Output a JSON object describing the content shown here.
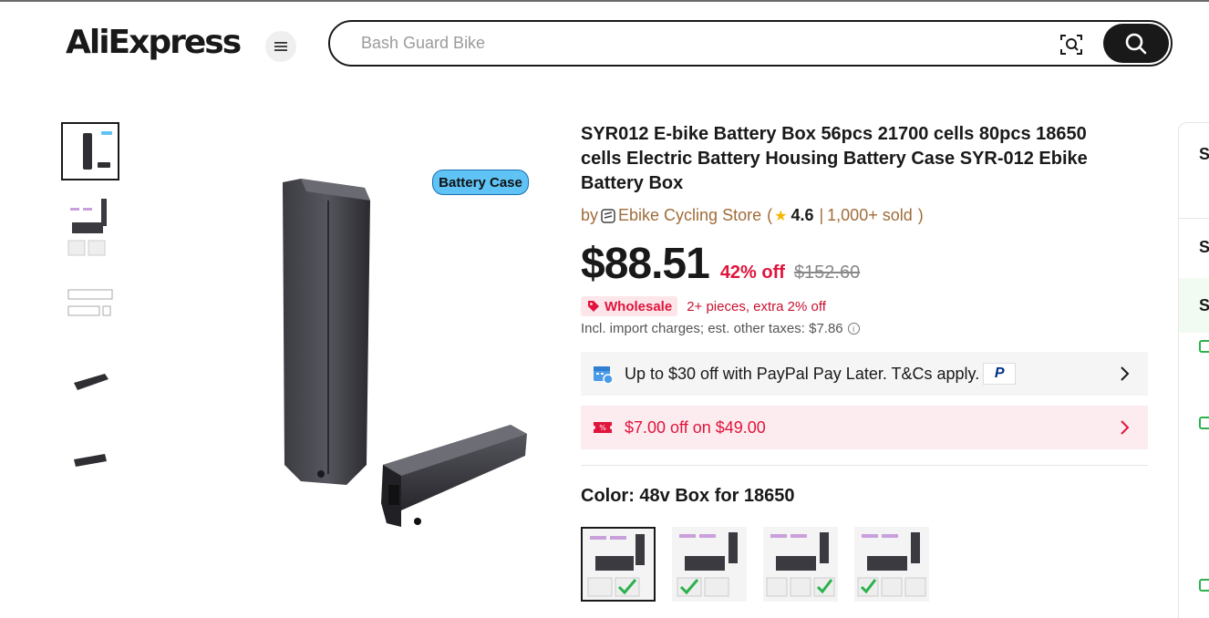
{
  "header": {
    "logo_text": "AliExpress",
    "search_placeholder": "Bash Guard Bike"
  },
  "gallery": {
    "badge_text": "Battery Case",
    "thumbnails": [
      "thumb-1",
      "thumb-2",
      "thumb-3",
      "thumb-4",
      "thumb-5"
    ]
  },
  "product": {
    "title": "SYR012 E-bike Battery Box 56pcs 21700 cells 80pcs 18650 cells Electric Battery Housing Battery Case SYR-012 Ebike Battery Box",
    "store_prefix": "by",
    "store_name": "Ebike Cycling Store",
    "store_open": "(",
    "rating": "4.6",
    "sold_sep": "|",
    "sold": "1,000+ sold",
    "store_close": ")",
    "price": "$88.51",
    "discount": "42% off",
    "original_price": "$152.60",
    "wholesale_badge": "Wholesale",
    "wholesale_text": "2+ pieces, extra 2% off",
    "tax_text": "Incl. import charges; est. other taxes: $7.86"
  },
  "promos": {
    "paypal_text": "Up to $30 off with PayPal Pay Later. T&Cs apply.",
    "coupon_text": "$7.00 off on $49.00"
  },
  "variants": {
    "color_label": "Color: 48v Box for 18650",
    "options": [
      "48v Box for 18650",
      "option-2",
      "option-3",
      "option-4"
    ]
  },
  "right_panel": {
    "letters": [
      "S",
      "S",
      "S"
    ]
  },
  "colors": {
    "accent_red": "#e0143c",
    "brand_orange": "#ff7a00",
    "store_brown": "#a06c3a",
    "dark": "#191919"
  }
}
